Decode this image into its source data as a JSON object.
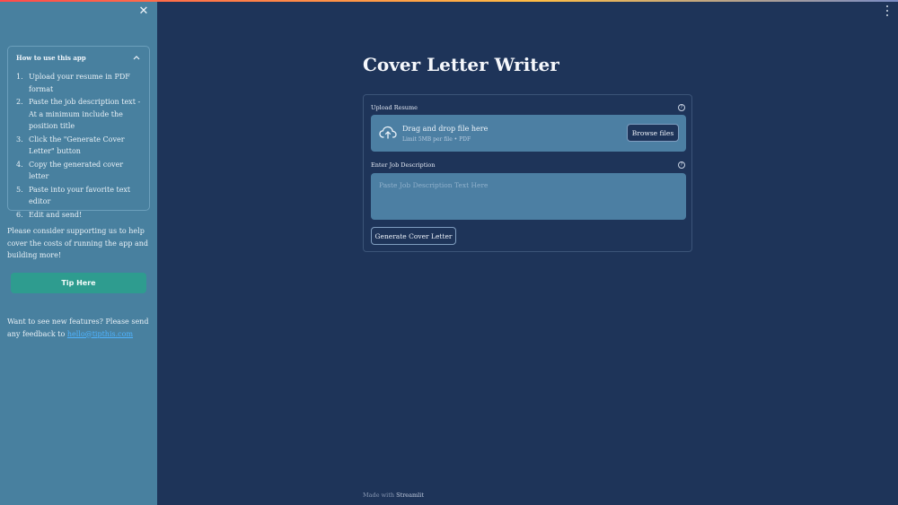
{
  "sidebar": {
    "close_glyph": "✕",
    "expander": {
      "title": "How to use this app",
      "steps": [
        {
          "num": "1.",
          "text": "Upload your resume in PDF format"
        },
        {
          "num": "2.",
          "text": "Paste the job description text - At a minimum include the position title"
        },
        {
          "num": "3.",
          "text": "Click the \"Generate Cover Letter\" button"
        },
        {
          "num": "4.",
          "text": "Copy the generated cover letter"
        },
        {
          "num": "5.",
          "text": "Paste into your favorite text editor"
        },
        {
          "num": "6.",
          "text": "Edit and send!"
        }
      ]
    },
    "support_text": "Please consider supporting us to help cover the costs of running the app and building more!",
    "tip_button": "Tip Here",
    "feedback_prefix": "Want to see new features? Please send any feedback to ",
    "feedback_link": "hello@tipthis.com"
  },
  "main": {
    "title": "Cover Letter Writer",
    "upload": {
      "label": "Upload Resume",
      "drop_title": "Drag and drop file here",
      "drop_limit": "Limit 5MB per file • PDF",
      "browse_button": "Browse files",
      "icon": "cloud-upload-icon"
    },
    "job_description": {
      "label": "Enter Job Description",
      "placeholder": "Paste Job Description Text Here",
      "value": ""
    },
    "generate_button": "Generate Cover Letter",
    "help_glyph": "?"
  },
  "footer": {
    "prefix": "Made with ",
    "brand": "Streamlit"
  },
  "colors": {
    "background": "#1e3459",
    "sidebar": "#48809f",
    "input": "#4c7fa3",
    "tip_button": "#2e9c8f",
    "link": "#4fb3ff"
  }
}
